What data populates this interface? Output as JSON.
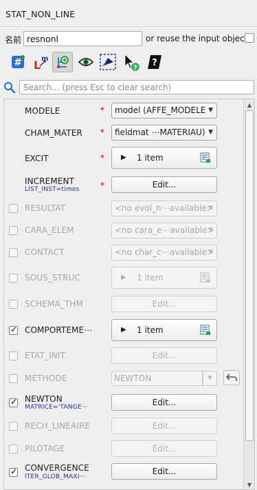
{
  "window": {
    "title": "STAT_NON_LINE"
  },
  "name_row": {
    "label": "名前",
    "value": "resnonl",
    "reuse_label": "or reuse the input object"
  },
  "toolbar": {
    "buttons": [
      {
        "icon": "hash-icon"
      },
      {
        "icon": "lm-icon"
      },
      {
        "icon": "tree-view-icon",
        "active": true
      },
      {
        "icon": "eye-icon"
      },
      {
        "icon": "selection-icon"
      },
      {
        "icon": "cursor-help-icon"
      },
      {
        "icon": "help-book-icon"
      }
    ]
  },
  "search": {
    "placeholder": "Search... (press Esc to clear search)"
  },
  "rows": [
    {
      "name": "MODELE",
      "checkbox": "none",
      "required": "*",
      "control": "combo",
      "value": "model (AFFE_MODELE"
    },
    {
      "name": "CHAM_MATER",
      "checkbox": "none",
      "required": "*",
      "control": "combo",
      "value": "fieldmat ⋯MATERIAU)"
    },
    {
      "name": "EXCIT",
      "checkbox": "none",
      "required": "*",
      "control": "items",
      "value": "1 item"
    },
    {
      "name": "INCREMENT",
      "sub": "LIST_INST=times",
      "checkbox": "none",
      "required": "*",
      "control": "edit",
      "value": "Edit..."
    },
    {
      "name": "RESULTAT",
      "checkbox": "off",
      "control": "combo-disabled",
      "value": "<no evol_n⋯available>"
    },
    {
      "name": "CARA_ELEM",
      "checkbox": "off",
      "control": "combo-disabled",
      "value": "<no cara_e⋯available>"
    },
    {
      "name": "CONTACT",
      "checkbox": "off",
      "control": "combo-disabled",
      "value": "<no char_c⋯available>"
    },
    {
      "name": "SOUS_STRUC",
      "checkbox": "off",
      "control": "items-disabled",
      "value": "1 item"
    },
    {
      "name": "SCHEMA_THM",
      "checkbox": "off",
      "control": "edit-disabled",
      "value": "Edit..."
    },
    {
      "name": "COMPORTEME⋯",
      "checkbox": "on",
      "control": "items",
      "value": "1 item"
    },
    {
      "name": "ETAT_INIT",
      "checkbox": "off",
      "control": "edit-disabled",
      "value": "Edit..."
    },
    {
      "name": "METHODE",
      "checkbox": "off",
      "control": "methode",
      "value": "NEWTON"
    },
    {
      "name": "NEWTON",
      "sub": "MATRICE='TANGE⋯",
      "checkbox": "on",
      "control": "edit",
      "value": "Edit..."
    },
    {
      "name": "RECH_LINEAIRE",
      "checkbox": "off",
      "control": "edit-disabled",
      "value": "Edit..."
    },
    {
      "name": "PILOTAGE",
      "checkbox": "off",
      "control": "edit-disabled",
      "value": "Edit..."
    },
    {
      "name": "CONVERGENCE",
      "sub": "ITER_GLOB_MAXI⋯",
      "checkbox": "on",
      "control": "edit",
      "value": "Edit..."
    }
  ],
  "colors": {
    "required": "#d40000",
    "subtitle": "#1f2fa8",
    "search_icon": "#1f6fd8"
  }
}
